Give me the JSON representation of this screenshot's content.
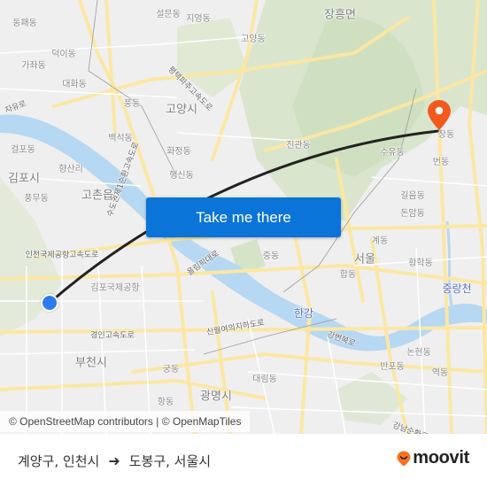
{
  "map": {
    "labels": [
      {
        "text": "설문동",
        "kind": "place"
      },
      {
        "text": "지영동",
        "kind": "place"
      },
      {
        "text": "동패동",
        "kind": "place"
      },
      {
        "text": "덕이동",
        "kind": "place"
      },
      {
        "text": "가좌동",
        "kind": "place"
      },
      {
        "text": "대화동",
        "kind": "place"
      },
      {
        "text": "풍동",
        "kind": "place"
      },
      {
        "text": "고양동",
        "kind": "place"
      },
      {
        "text": "장흥면",
        "kind": "city"
      },
      {
        "text": "고양시",
        "kind": "city"
      },
      {
        "text": "백석동",
        "kind": "place"
      },
      {
        "text": "화정동",
        "kind": "place"
      },
      {
        "text": "행신동",
        "kind": "place"
      },
      {
        "text": "진관동",
        "kind": "place"
      },
      {
        "text": "걸포동",
        "kind": "place"
      },
      {
        "text": "향산리",
        "kind": "place"
      },
      {
        "text": "김포시",
        "kind": "city"
      },
      {
        "text": "고촌읍",
        "kind": "city"
      },
      {
        "text": "풍무동",
        "kind": "place"
      },
      {
        "text": "창동",
        "kind": "place"
      },
      {
        "text": "수유동",
        "kind": "place"
      },
      {
        "text": "번동",
        "kind": "place"
      },
      {
        "text": "길음동",
        "kind": "place"
      },
      {
        "text": "돈암동",
        "kind": "place"
      },
      {
        "text": "계동",
        "kind": "place"
      },
      {
        "text": "서울",
        "kind": "city"
      },
      {
        "text": "황학동",
        "kind": "place"
      },
      {
        "text": "중랑천",
        "kind": "river"
      },
      {
        "text": "중동",
        "kind": "place"
      },
      {
        "text": "합동",
        "kind": "place"
      },
      {
        "text": "김포국제공항",
        "kind": "place"
      },
      {
        "text": "한강",
        "kind": "river"
      },
      {
        "text": "올림픽대로",
        "kind": "road"
      },
      {
        "text": "신월여의지하도로",
        "kind": "road"
      },
      {
        "text": "경인고속도로",
        "kind": "road"
      },
      {
        "text": "인천국제공항고속도로",
        "kind": "road"
      },
      {
        "text": "강변북로",
        "kind": "road"
      },
      {
        "text": "부천시",
        "kind": "city"
      },
      {
        "text": "궁동",
        "kind": "place"
      },
      {
        "text": "대림동",
        "kind": "place"
      },
      {
        "text": "광명시",
        "kind": "city"
      },
      {
        "text": "항동",
        "kind": "place"
      },
      {
        "text": "논현동",
        "kind": "place"
      },
      {
        "text": "반포동",
        "kind": "place"
      },
      {
        "text": "역동",
        "kind": "place"
      },
      {
        "text": "강남순환로",
        "kind": "road"
      },
      {
        "text": "평택파주고속도로",
        "kind": "road"
      },
      {
        "text": "수도권제1순환고속도로",
        "kind": "road"
      },
      {
        "text": "자유로",
        "kind": "road"
      }
    ],
    "origin_marker": {
      "color": "#2d7bf0"
    },
    "destination_marker": {
      "color": "#f25a1d",
      "icon": "map-pin-icon"
    },
    "route_line_color": "#222222",
    "attribution": "© OpenStreetMap contributors | © OpenMapTiles"
  },
  "cta": {
    "label": "Take me there",
    "color": "#0a74d8"
  },
  "footer": {
    "origin": "계양구, 인천시",
    "arrow_icon": "arrow-right-icon",
    "destination": "도봉구, 서울시",
    "brand": "moovit",
    "brand_color": "#f5731f"
  }
}
